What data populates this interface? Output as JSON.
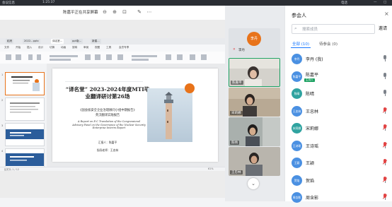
{
  "topbar": {
    "left_a": "会议信息",
    "left_b": "1:25:37",
    "right_a": "电话",
    "right_b": "—",
    "right_c": "□"
  },
  "share": {
    "text": "陈嘉平正在共享屏幕",
    "zoom_out": "⊖",
    "zoom_in": "⊕",
    "fit": "⊡",
    "annotate": "✎",
    "more": "⋯"
  },
  "wps": {
    "tabs": [
      "稻壳",
      "2022...pptx",
      "译名堂...",
      "ppt版...",
      "新建..."
    ],
    "ribbon": [
      "文件",
      "开始",
      "插入",
      "设计",
      "切换",
      "动画",
      "放映",
      "审阅",
      "视图",
      "工具",
      "会员专享"
    ],
    "status_left": "幻灯片 1 / 12",
    "status_right": "61%"
  },
  "slide": {
    "title_line1": "“译名堂” 2023-2024年度MTI毕",
    "title_line2": "业翻译研讨第26场",
    "subtitle1": "《国会核安全企业治理顾问小组中期报告》",
    "subtitle2": "英汉翻译实践报告",
    "english": "A Report on E-C Translation of the Congressional Advisory Panel on the Governance of the Nuclear Security Enterprise Interim Report",
    "reporter": "汇报人：陈嘉平",
    "advisor": "指导老师：王忠林"
  },
  "videos": [
    {
      "name": "李丹",
      "avatar_text": "李丹"
    },
    {
      "name": "陈嘉平"
    },
    {
      "name": "宋莉娜"
    },
    {
      "name": "陈晴"
    },
    {
      "name": "王忠林"
    }
  ],
  "panel": {
    "title": "参会人",
    "search_placeholder": "搜索成员",
    "invite": "邀请",
    "tab_all": "全部 (10)",
    "tab_waiting": "待参会 (0)",
    "members": [
      {
        "avatar": "李丹",
        "name": "李丹 (我)",
        "color": "#4a90e2",
        "mic": "active",
        "badge": ""
      },
      {
        "avatar": "陈嘉平",
        "name": "陈嘉平",
        "color": "#4a90e2",
        "mic": "active",
        "badge": "主持人"
      },
      {
        "avatar": "陈晴",
        "name": "陈晴",
        "color": "#2fa3a0",
        "mic": "active",
        "badge": ""
      },
      {
        "avatar": "王忠林",
        "name": "王忠林",
        "color": "#4a90e2",
        "mic": "muted",
        "badge": ""
      },
      {
        "avatar": "宋莉娜",
        "name": "宋莉娜",
        "color": "#2fa3a0",
        "mic": "muted",
        "badge": ""
      },
      {
        "avatar": "王诗瑶",
        "name": "王诗瑶",
        "color": "#4a90e2",
        "mic": "muted",
        "badge": ""
      },
      {
        "avatar": "王颖",
        "name": "王颖",
        "color": "#4a90e2",
        "mic": "muted",
        "badge": ""
      },
      {
        "avatar": "贺焰",
        "name": "贺焰",
        "color": "#4a90e2",
        "mic": "muted",
        "badge": ""
      },
      {
        "avatar": "周含影",
        "name": "周含影",
        "color": "#4a90e2",
        "mic": "muted",
        "badge": ""
      }
    ]
  },
  "colors": {
    "accent": "#1677ff",
    "mic_active": "#1aa060",
    "mic_muted": "#e24444",
    "orange": "#e8731a"
  }
}
